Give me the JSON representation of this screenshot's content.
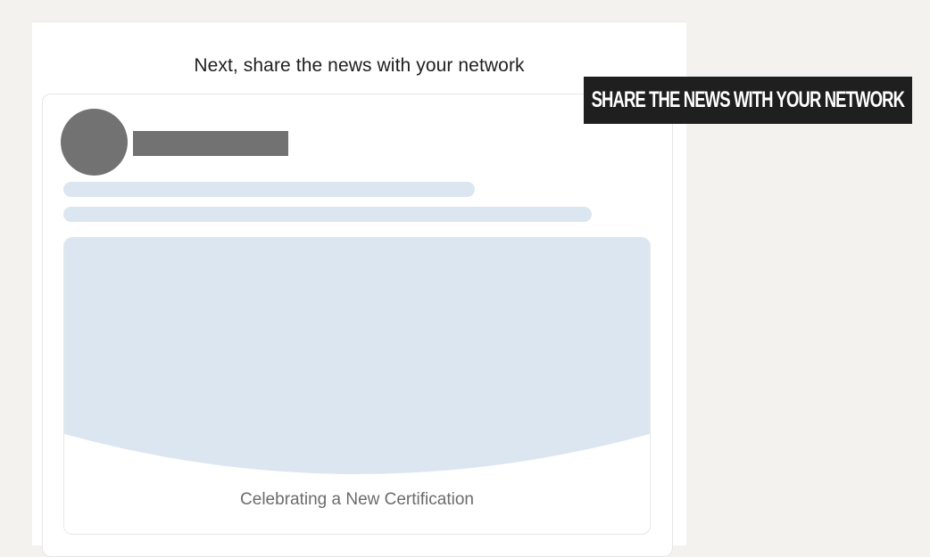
{
  "share_panel": {
    "heading": "Next, share the news with your network"
  },
  "post_preview": {
    "media_caption": "Celebrating a New Certification"
  },
  "overlay_banner": {
    "text": "SHARE THE NEWS WITH YOUR NETWORK"
  },
  "colors": {
    "page_background": "#f3f2ef",
    "panel_background": "#ffffff",
    "placeholder_gray": "#737272",
    "placeholder_blue": "#dce6f0",
    "overlay_background": "#1f1f1f",
    "overlay_text": "#ffffff"
  }
}
